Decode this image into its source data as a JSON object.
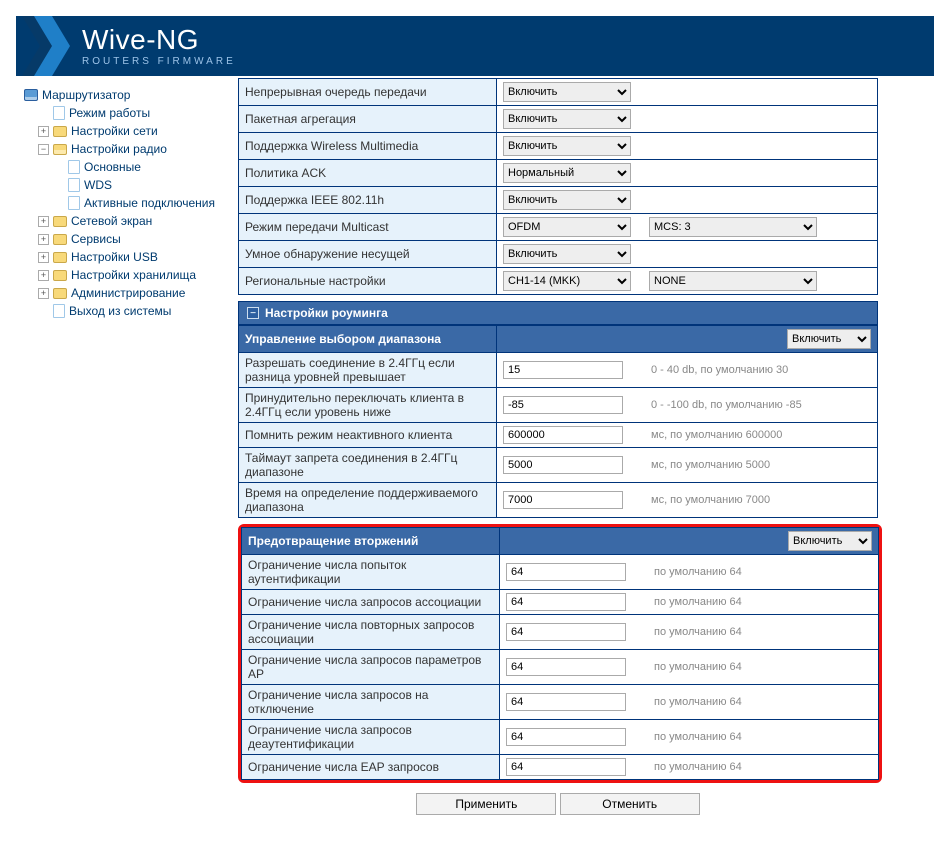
{
  "brand": {
    "line1": "Wive-NG",
    "line2": "ROUTERS FIRMWARE"
  },
  "nav": {
    "root": "Маршрутизатор",
    "mode": "Режим работы",
    "net": "Настройки сети",
    "radio": "Настройки радио",
    "radio_items": {
      "basic": "Основные",
      "wds": "WDS",
      "active": "Активные подключения"
    },
    "firewall": "Сетевой экран",
    "services": "Сервисы",
    "usb": "Настройки USB",
    "storage": "Настройки хранилища",
    "admin": "Администрирование",
    "logout": "Выход из системы"
  },
  "top_rows": [
    {
      "label": "Непрерывная очередь передачи",
      "sel": "Включить"
    },
    {
      "label": "Пакетная агрегация",
      "sel": "Включить"
    },
    {
      "label": "Поддержка Wireless Multimedia",
      "sel": "Включить"
    },
    {
      "label": "Политика ACK",
      "sel": "Нормальный"
    },
    {
      "label": "Поддержка IEEE 802.11h",
      "sel": "Включить"
    },
    {
      "label": "Режим передачи Multicast",
      "sel": "OFDM",
      "sel2": "MCS: 3"
    },
    {
      "label": "Умное обнаружение несущей",
      "sel": "Включить"
    },
    {
      "label": "Региональные настройки",
      "sel": "CH1-14 (MKK)",
      "sel2": "NONE"
    }
  ],
  "roaming_section": "Настройки роуминга",
  "band": {
    "header": "Управление выбором диапазона",
    "toggle": "Включить"
  },
  "band_rows": [
    {
      "label": "Разрешать соединение в 2.4ГГц если разница уровней превышает",
      "val": "15",
      "hint": "0 - 40 db, по умолчанию 30"
    },
    {
      "label": "Принудительно переключать клиента в 2.4ГГц если уровень ниже",
      "val": "-85",
      "hint": "0 - -100 db, по умолчанию -85"
    },
    {
      "label": "Помнить режим неактивного клиента",
      "val": "600000",
      "hint": "мс, по умолчанию 600000"
    },
    {
      "label": "Таймаут запрета соединения в 2.4ГГц диапазоне",
      "val": "5000",
      "hint": "мс, по умолчанию 5000"
    },
    {
      "label": "Время на определение поддерживаемого диапазона",
      "val": "7000",
      "hint": "мс, по умолчанию 7000"
    }
  ],
  "ids": {
    "header": "Предотвращение вторжений",
    "toggle": "Включить"
  },
  "ids_rows": [
    {
      "label": "Ограничение числа попыток аутентификации",
      "val": "64",
      "hint": "по умолчанию 64"
    },
    {
      "label": "Ограничение числа запросов ассоциации",
      "val": "64",
      "hint": "по умолчанию 64"
    },
    {
      "label": "Ограничение числа повторных запросов ассоциации",
      "val": "64",
      "hint": "по умолчанию 64"
    },
    {
      "label": "Ограничение числа запросов параметров AP",
      "val": "64",
      "hint": "по умолчанию 64"
    },
    {
      "label": "Ограничение числа запросов на отключение",
      "val": "64",
      "hint": "по умолчанию 64"
    },
    {
      "label": "Ограничение числа запросов деаутентификации",
      "val": "64",
      "hint": "по умолчанию 64"
    },
    {
      "label": "Ограничение числа EAP запросов",
      "val": "64",
      "hint": "по умолчанию 64"
    }
  ],
  "buttons": {
    "apply": "Применить",
    "cancel": "Отменить"
  }
}
